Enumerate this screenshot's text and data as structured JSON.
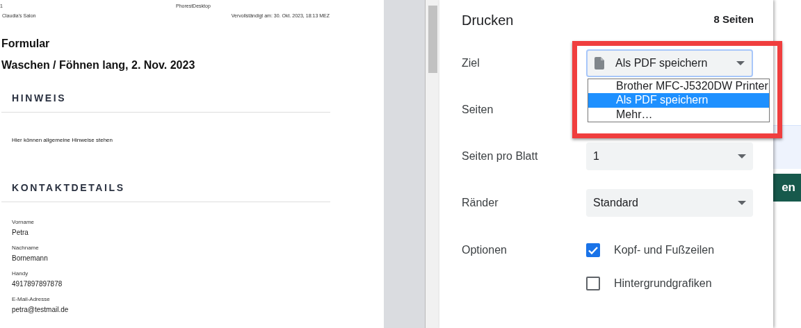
{
  "preview": {
    "header": {
      "page_number": "1",
      "app": "PhorestDesktop",
      "salon": "Claudia's Salon",
      "completed": "Vervollständigt am: 30. Okt. 2023, 18:13 MEZ"
    },
    "title": "Formular",
    "subtitle": "Waschen / Föhnen lang, 2. Nov. 2023",
    "sections": [
      {
        "heading": "HINWEIS",
        "text": "Hier können allgemeine Hinweise stehen"
      },
      {
        "heading": "KONTAKTDETAILS",
        "fields": [
          {
            "label": "Vorname",
            "value": "Petra"
          },
          {
            "label": "Nachname",
            "value": "Bornemann"
          },
          {
            "label": "Handy",
            "value": "4917897897878"
          },
          {
            "label": "E-Mail-Adresse",
            "value": "petra@testmail.de"
          }
        ]
      }
    ]
  },
  "print_dialog": {
    "title": "Drucken",
    "page_count": "8 Seiten",
    "settings": [
      {
        "kind": "destination",
        "label": "Ziel",
        "value": "Als PDF speichern",
        "expanded": true,
        "highlighted": true,
        "options": [
          {
            "label": "Brother MFC-J5320DW Printer",
            "selected": false
          },
          {
            "label": "Als PDF speichern",
            "selected": true
          },
          {
            "label": "Mehr…",
            "selected": false
          }
        ]
      },
      {
        "kind": "hidden",
        "label": "Seiten"
      },
      {
        "kind": "select",
        "label": "Seiten pro Blatt",
        "value": "1"
      },
      {
        "kind": "select",
        "label": "Ränder",
        "value": "Standard"
      },
      {
        "kind": "checkboxes",
        "label": "Optionen",
        "items": [
          {
            "label": "Kopf- und Fußzeilen",
            "checked": true
          },
          {
            "label": "Hintergrundgrafiken",
            "checked": false
          }
        ]
      }
    ]
  },
  "background_button": {
    "label": "en"
  }
}
